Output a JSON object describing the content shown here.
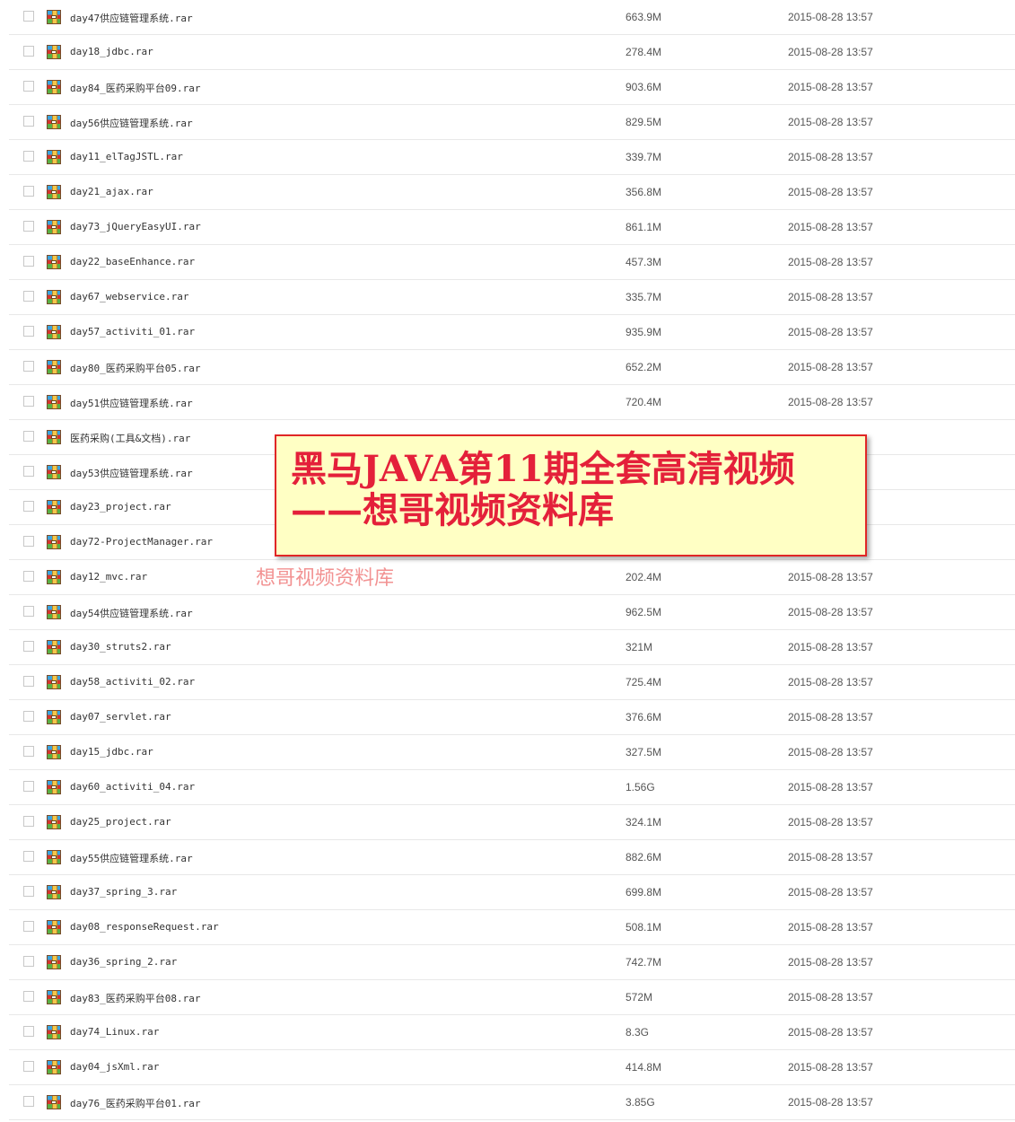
{
  "files": [
    {
      "name": "day47供应链管理系统.rar",
      "size": "663.9M",
      "date": "2015-08-28 13:57"
    },
    {
      "name": "day18_jdbc.rar",
      "size": "278.4M",
      "date": "2015-08-28 13:57"
    },
    {
      "name": "day84_医药采购平台09.rar",
      "size": "903.6M",
      "date": "2015-08-28 13:57"
    },
    {
      "name": "day56供应链管理系统.rar",
      "size": "829.5M",
      "date": "2015-08-28 13:57"
    },
    {
      "name": "day11_elTagJSTL.rar",
      "size": "339.7M",
      "date": "2015-08-28 13:57"
    },
    {
      "name": "day21_ajax.rar",
      "size": "356.8M",
      "date": "2015-08-28 13:57"
    },
    {
      "name": "day73_jQueryEasyUI.rar",
      "size": "861.1M",
      "date": "2015-08-28 13:57"
    },
    {
      "name": "day22_baseEnhance.rar",
      "size": "457.3M",
      "date": "2015-08-28 13:57"
    },
    {
      "name": "day67_webservice.rar",
      "size": "335.7M",
      "date": "2015-08-28 13:57"
    },
    {
      "name": "day57_activiti_01.rar",
      "size": "935.9M",
      "date": "2015-08-28 13:57"
    },
    {
      "name": "day80_医药采购平台05.rar",
      "size": "652.2M",
      "date": "2015-08-28 13:57"
    },
    {
      "name": "day51供应链管理系统.rar",
      "size": "720.4M",
      "date": "2015-08-28 13:57"
    },
    {
      "name": "医药采购(工具&文档).rar",
      "size": "",
      "date": ""
    },
    {
      "name": "day53供应链管理系统.rar",
      "size": "",
      "date": ""
    },
    {
      "name": "day23_project.rar",
      "size": "",
      "date": ""
    },
    {
      "name": "day72-ProjectManager.rar",
      "size": "",
      "date": ""
    },
    {
      "name": "day12_mvc.rar",
      "size": "202.4M",
      "date": "2015-08-28 13:57"
    },
    {
      "name": "day54供应链管理系统.rar",
      "size": "962.5M",
      "date": "2015-08-28 13:57"
    },
    {
      "name": "day30_struts2.rar",
      "size": "321M",
      "date": "2015-08-28 13:57"
    },
    {
      "name": "day58_activiti_02.rar",
      "size": "725.4M",
      "date": "2015-08-28 13:57"
    },
    {
      "name": "day07_servlet.rar",
      "size": "376.6M",
      "date": "2015-08-28 13:57"
    },
    {
      "name": "day15_jdbc.rar",
      "size": "327.5M",
      "date": "2015-08-28 13:57"
    },
    {
      "name": "day60_activiti_04.rar",
      "size": "1.56G",
      "date": "2015-08-28 13:57"
    },
    {
      "name": "day25_project.rar",
      "size": "324.1M",
      "date": "2015-08-28 13:57"
    },
    {
      "name": "day55供应链管理系统.rar",
      "size": "882.6M",
      "date": "2015-08-28 13:57"
    },
    {
      "name": "day37_spring_3.rar",
      "size": "699.8M",
      "date": "2015-08-28 13:57"
    },
    {
      "name": "day08_responseRequest.rar",
      "size": "508.1M",
      "date": "2015-08-28 13:57"
    },
    {
      "name": "day36_spring_2.rar",
      "size": "742.7M",
      "date": "2015-08-28 13:57"
    },
    {
      "name": "day83_医药采购平台08.rar",
      "size": "572M",
      "date": "2015-08-28 13:57"
    },
    {
      "name": "day74_Linux.rar",
      "size": "8.3G",
      "date": "2015-08-28 13:57"
    },
    {
      "name": "day04_jsXml.rar",
      "size": "414.8M",
      "date": "2015-08-28 13:57"
    },
    {
      "name": "day76_医药采购平台01.rar",
      "size": "3.85G",
      "date": "2015-08-28 13:57"
    }
  ],
  "banner": {
    "line1": "黑马JAVA第11期全套高清视频",
    "line2": "——想哥视频资料库"
  },
  "watermark": "想哥视频资料库",
  "icons": {
    "file": "rar-archive-icon",
    "select": "checkbox"
  },
  "colors": {
    "banner_bg": "#ffffc4",
    "banner_border": "#e02626",
    "banner_text": "#e4203a",
    "row_divider": "#e8e8e8"
  }
}
